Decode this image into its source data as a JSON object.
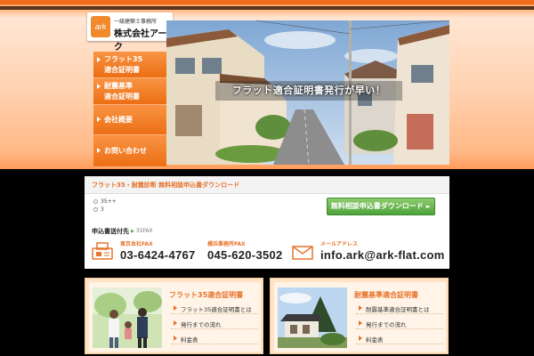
{
  "brand": {
    "logo_mark": "ark",
    "subtitle": "一級建築士事務所",
    "name": "株式会社アーク"
  },
  "sidenav": {
    "items": [
      {
        "line1": "フラット35",
        "line2": "適合証明書"
      },
      {
        "line1": "耐震基準",
        "line2": "適合証明書"
      },
      {
        "line1": "会社概要",
        "line2": ""
      },
      {
        "line1": "お問い合わせ",
        "line2": ""
      }
    ]
  },
  "hero": {
    "caption": "フラット適合証明書発行が早い！"
  },
  "download": {
    "title": "フラット35・耐震診断 無料相談申込書ダウンロード",
    "options": [
      "35++",
      "3"
    ],
    "button_label": "無料相談申込書ダウンロード",
    "send_label": "申込書送付先",
    "send_note": "35FAX"
  },
  "contacts": [
    {
      "label": "東京本社FAX",
      "value": "03-6424-4767",
      "icon": "fax-icon"
    },
    {
      "label": "横浜事務所FAX",
      "value": "045-620-3502",
      "icon": "fax-icon"
    },
    {
      "label": "メールアドレス",
      "value": "info.ark@ark-flat.com",
      "icon": "mail-icon"
    }
  ],
  "cards": [
    {
      "title": "フラット35適合証明書",
      "links": [
        "フラット35適合証明書とは",
        "発行までの流れ",
        "料金表"
      ]
    },
    {
      "title": "耐震基準適合証明書",
      "links": [
        "耐震基準適合証明書とは",
        "発行までの流れ",
        "料金表"
      ]
    }
  ],
  "colors": {
    "accent": "#e8732c",
    "nav_orange": "#f37b20",
    "button_green": "#4ea33b"
  }
}
